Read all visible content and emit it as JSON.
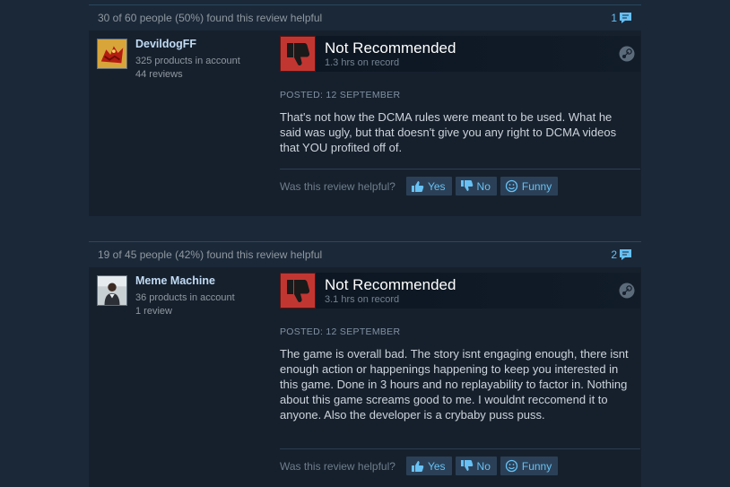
{
  "reviews": [
    {
      "helpful_summary": "30 of 60 people (50%) found this review helpful",
      "comment_count": "1",
      "author": {
        "name": "DevildogFF",
        "products": "325 products in account",
        "reviews": "44 reviews",
        "avatar_icon": "red-dragon-avatar"
      },
      "verdict": "Not Recommended",
      "hours": "1.3 hrs on record",
      "posted": "POSTED: 12 SEPTEMBER",
      "text": "That's not how the DCMA rules were meant to be used. What he said was ugly, but that doesn't give you any right to DCMA videos that YOU profited off of.",
      "vote_prompt": "Was this review helpful?",
      "yes": "Yes",
      "no": "No",
      "funny": "Funny"
    },
    {
      "helpful_summary": "19 of 45 people (42%) found this review helpful",
      "comment_count": "2",
      "author": {
        "name": "Meme Machine",
        "products": "36 products in account",
        "reviews": "1 review",
        "avatar_icon": "person-photo-avatar"
      },
      "verdict": "Not Recommended",
      "hours": "3.1 hrs on record",
      "posted": "POSTED: 12 SEPTEMBER",
      "text": "The game is overall bad. The story isnt engaging enough, there isnt enough action or happenings happening to keep you interested in this game. Done in 3 hours and no replayability to factor in. Nothing about this game screams good to me. I wouldnt reccomend it to anyone. Also the developer is a crybaby puss puss.",
      "vote_prompt": "Was this review helpful?",
      "yes": "Yes",
      "no": "No",
      "funny": "Funny"
    }
  ],
  "colors": {
    "background": "#1b2838",
    "panel": "#16202d",
    "thumb_down": "#c23632",
    "link": "#67c1f5"
  }
}
